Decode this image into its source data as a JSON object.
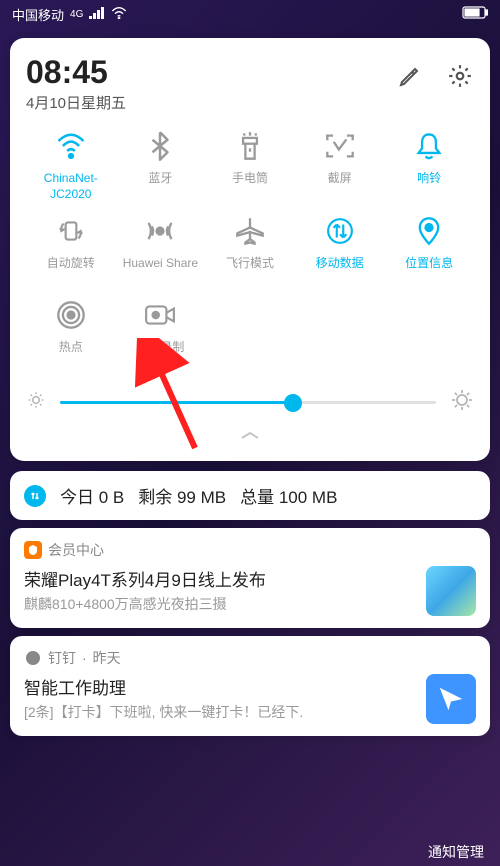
{
  "status_bar": {
    "carrier": "中国移动",
    "network_badge": "4G"
  },
  "panel": {
    "time": "08:45",
    "date": "4月10日星期五",
    "brightness_percent": 62
  },
  "toggles": [
    {
      "id": "wifi",
      "label": "ChinaNet-JC2020",
      "active": true
    },
    {
      "id": "bluetooth",
      "label": "蓝牙",
      "active": false
    },
    {
      "id": "flashlight",
      "label": "手电筒",
      "active": false
    },
    {
      "id": "screenshot",
      "label": "截屏",
      "active": false
    },
    {
      "id": "ringer",
      "label": "响铃",
      "active": true
    },
    {
      "id": "rotation",
      "label": "自动旋转",
      "active": false
    },
    {
      "id": "huawei-share",
      "label": "Huawei Share",
      "active": false
    },
    {
      "id": "airplane",
      "label": "飞行模式",
      "active": false
    },
    {
      "id": "mobile-data",
      "label": "移动数据",
      "active": true
    },
    {
      "id": "location",
      "label": "位置信息",
      "active": true
    },
    {
      "id": "hotspot",
      "label": "热点",
      "active": false
    },
    {
      "id": "screen-record",
      "label": "屏幕录制",
      "active": false
    }
  ],
  "data_usage": {
    "today": "今日 0 B",
    "remaining": "剩余 99 MB",
    "total": "总量 100 MB"
  },
  "notifications": [
    {
      "app": "会员中心",
      "time": "",
      "title": "荣耀Play4T系列4月9日线上发布",
      "subtitle": "麒麟810+4800万高感光夜拍三摄",
      "icon_bg": "#ff7a00"
    },
    {
      "app": "钉钉",
      "time": "昨天",
      "title": "智能工作助理",
      "subtitle": "[2条]【打卡】下班啦, 快来一键打卡！已经下.",
      "icon_bg": "#888"
    }
  ],
  "manage_label": "通知管理"
}
